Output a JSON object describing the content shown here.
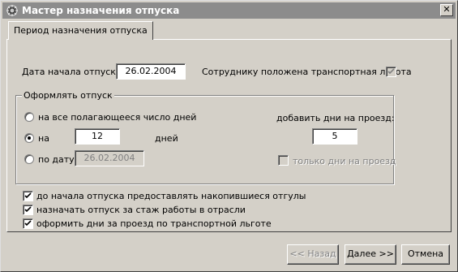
{
  "window": {
    "title": "Мастер назначения отпуска",
    "close_glyph": "✕"
  },
  "tab": {
    "label": "Период назначения отпуска"
  },
  "start_date": {
    "label": "Дата начала отпуска",
    "value": "26.02.2004"
  },
  "transport_benefit": {
    "label": "Сотруднику положена транспортная льгота",
    "checked": true,
    "enabled": false
  },
  "group": {
    "title": "Оформлять отпуск",
    "option_all_days": {
      "label": "на все полагающееся число дней",
      "selected": false
    },
    "option_days": {
      "label": "на",
      "value": "12",
      "unit": "дней",
      "selected": true
    },
    "option_date": {
      "label": "по дату",
      "value": "26.02.2004",
      "selected": false
    },
    "travel_days": {
      "label": "добавить дни  на проезд:",
      "value": "5"
    },
    "travel_only": {
      "label": "только дни на проезд",
      "checked": false,
      "enabled": false
    }
  },
  "options": [
    {
      "label": "до начала отпуска предоставлять накопившиеся отгулы",
      "checked": true
    },
    {
      "label": "назначать отпуск за стаж работы в отрасли",
      "checked": true
    },
    {
      "label": "оформить дни за проезд по транспортной льготе",
      "checked": true
    }
  ],
  "buttons": {
    "back": "<< Назад",
    "next": "Далее >>",
    "cancel": "Отмена"
  },
  "colors": {
    "face": "#d4d0c8",
    "titlebar": "#8c8c8c",
    "disabled_text": "#808080"
  }
}
